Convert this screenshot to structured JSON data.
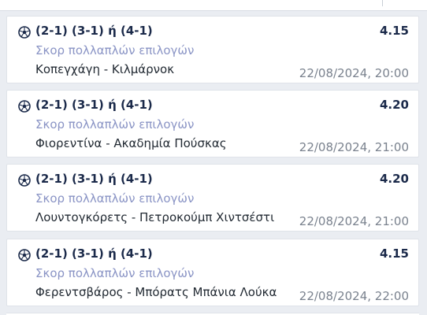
{
  "bets": [
    {
      "pick": "(2-1) (3-1) ή (4-1)",
      "odds": "4.15",
      "market": "Σκορ πολλαπλών επιλογών",
      "event": "Κοπεγχάγη - Κιλμάρνοκ",
      "datetime": "22/08/2024, 20:00"
    },
    {
      "pick": "(2-1) (3-1) ή (4-1)",
      "odds": "4.20",
      "market": "Σκορ πολλαπλών επιλογών",
      "event": "Φιορεντίνα - Ακαδημία Πούσκας",
      "datetime": "22/08/2024, 21:00"
    },
    {
      "pick": "(2-1) (3-1) ή (4-1)",
      "odds": "4.20",
      "market": "Σκορ πολλαπλών επιλογών",
      "event": "Λουντογκόρετς - Πετροκούμπ Χιντσέστι",
      "datetime": "22/08/2024, 21:00"
    },
    {
      "pick": "(2-1) (3-1) ή (4-1)",
      "odds": "4.15",
      "market": "Σκορ πολλαπλών επιλογών",
      "event": "Φερεντσβάρος - Μπόρατς Μπάνια Λούκα",
      "datetime": "22/08/2024, 22:00"
    }
  ],
  "icons": {
    "sport": "football-icon"
  },
  "colors": {
    "background": "#eaedf2",
    "card": "#ffffff",
    "text_dark": "#1b2a4a",
    "market_text": "#8a94c5",
    "date_text": "#7a828e"
  }
}
